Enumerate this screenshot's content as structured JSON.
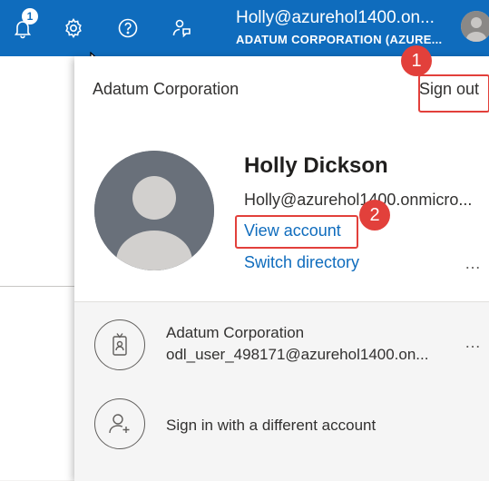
{
  "topbar": {
    "notifications_count": "1",
    "user_email": "Holly@azurehol1400.on...",
    "tenant": "ADATUM CORPORATION (AZURE...",
    "icons": [
      "bell-icon",
      "gear-icon",
      "help-icon",
      "feedback-icon"
    ]
  },
  "panel": {
    "org_name": "Adatum Corporation",
    "sign_out_label": "Sign out",
    "user_name": "Holly Dickson",
    "user_email": "Holly@azurehol1400.onmicro...",
    "view_account_label": "View account",
    "switch_directory_label": "Switch directory",
    "more_label": "…"
  },
  "other_accounts": {
    "org_name": "Adatum Corporation",
    "account_email": "odl_user_498171@azurehol1400.on...",
    "more_label": "…",
    "sign_in_different": "Sign in with a different account"
  },
  "callouts": [
    "1",
    "2"
  ],
  "colors": {
    "accent": "#0f6cbd",
    "highlight": "#e2403b"
  }
}
